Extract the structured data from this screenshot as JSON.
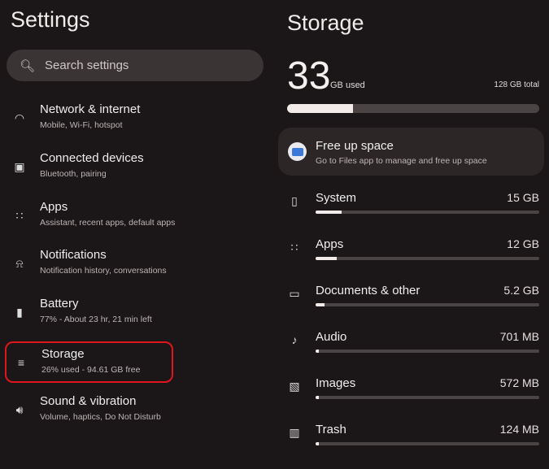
{
  "left": {
    "title": "Settings",
    "search_placeholder": "Search settings",
    "items": [
      {
        "label": "Network & internet",
        "sub": "Mobile, Wi-Fi, hotspot",
        "icon": "wifi-icon"
      },
      {
        "label": "Connected devices",
        "sub": "Bluetooth, pairing",
        "icon": "devices-icon"
      },
      {
        "label": "Apps",
        "sub": "Assistant, recent apps, default apps",
        "icon": "apps-grid-icon"
      },
      {
        "label": "Notifications",
        "sub": "Notification history, conversations",
        "icon": "bell-icon"
      },
      {
        "label": "Battery",
        "sub": "77% - About 23 hr, 21 min left",
        "icon": "battery-icon"
      },
      {
        "label": "Storage",
        "sub": "26% used - 94.61 GB free",
        "icon": "storage-icon",
        "selected": true
      },
      {
        "label": "Sound & vibration",
        "sub": "Volume, haptics, Do Not Disturb",
        "icon": "speaker-icon"
      }
    ]
  },
  "right": {
    "title": "Storage",
    "used": "33",
    "used_unit": "GB used",
    "total": "128 GB total",
    "used_fraction": 0.26,
    "card": {
      "title": "Free up space",
      "sub": "Go to Files app to manage and free up space",
      "icon": "files-app-icon"
    },
    "categories": [
      {
        "name": "System",
        "value": "15 GB",
        "fraction": 0.117,
        "icon": "phone-icon"
      },
      {
        "name": "Apps",
        "value": "12 GB",
        "fraction": 0.094,
        "icon": "apps-grid-icon"
      },
      {
        "name": "Documents & other",
        "value": "5.2 GB",
        "fraction": 0.04,
        "icon": "folder-icon"
      },
      {
        "name": "Audio",
        "value": "701 MB",
        "fraction": 0.005,
        "icon": "music-note-icon"
      },
      {
        "name": "Images",
        "value": "572 MB",
        "fraction": 0.004,
        "icon": "image-icon"
      },
      {
        "name": "Trash",
        "value": "124 MB",
        "fraction": 0.001,
        "icon": "trash-icon"
      }
    ]
  }
}
